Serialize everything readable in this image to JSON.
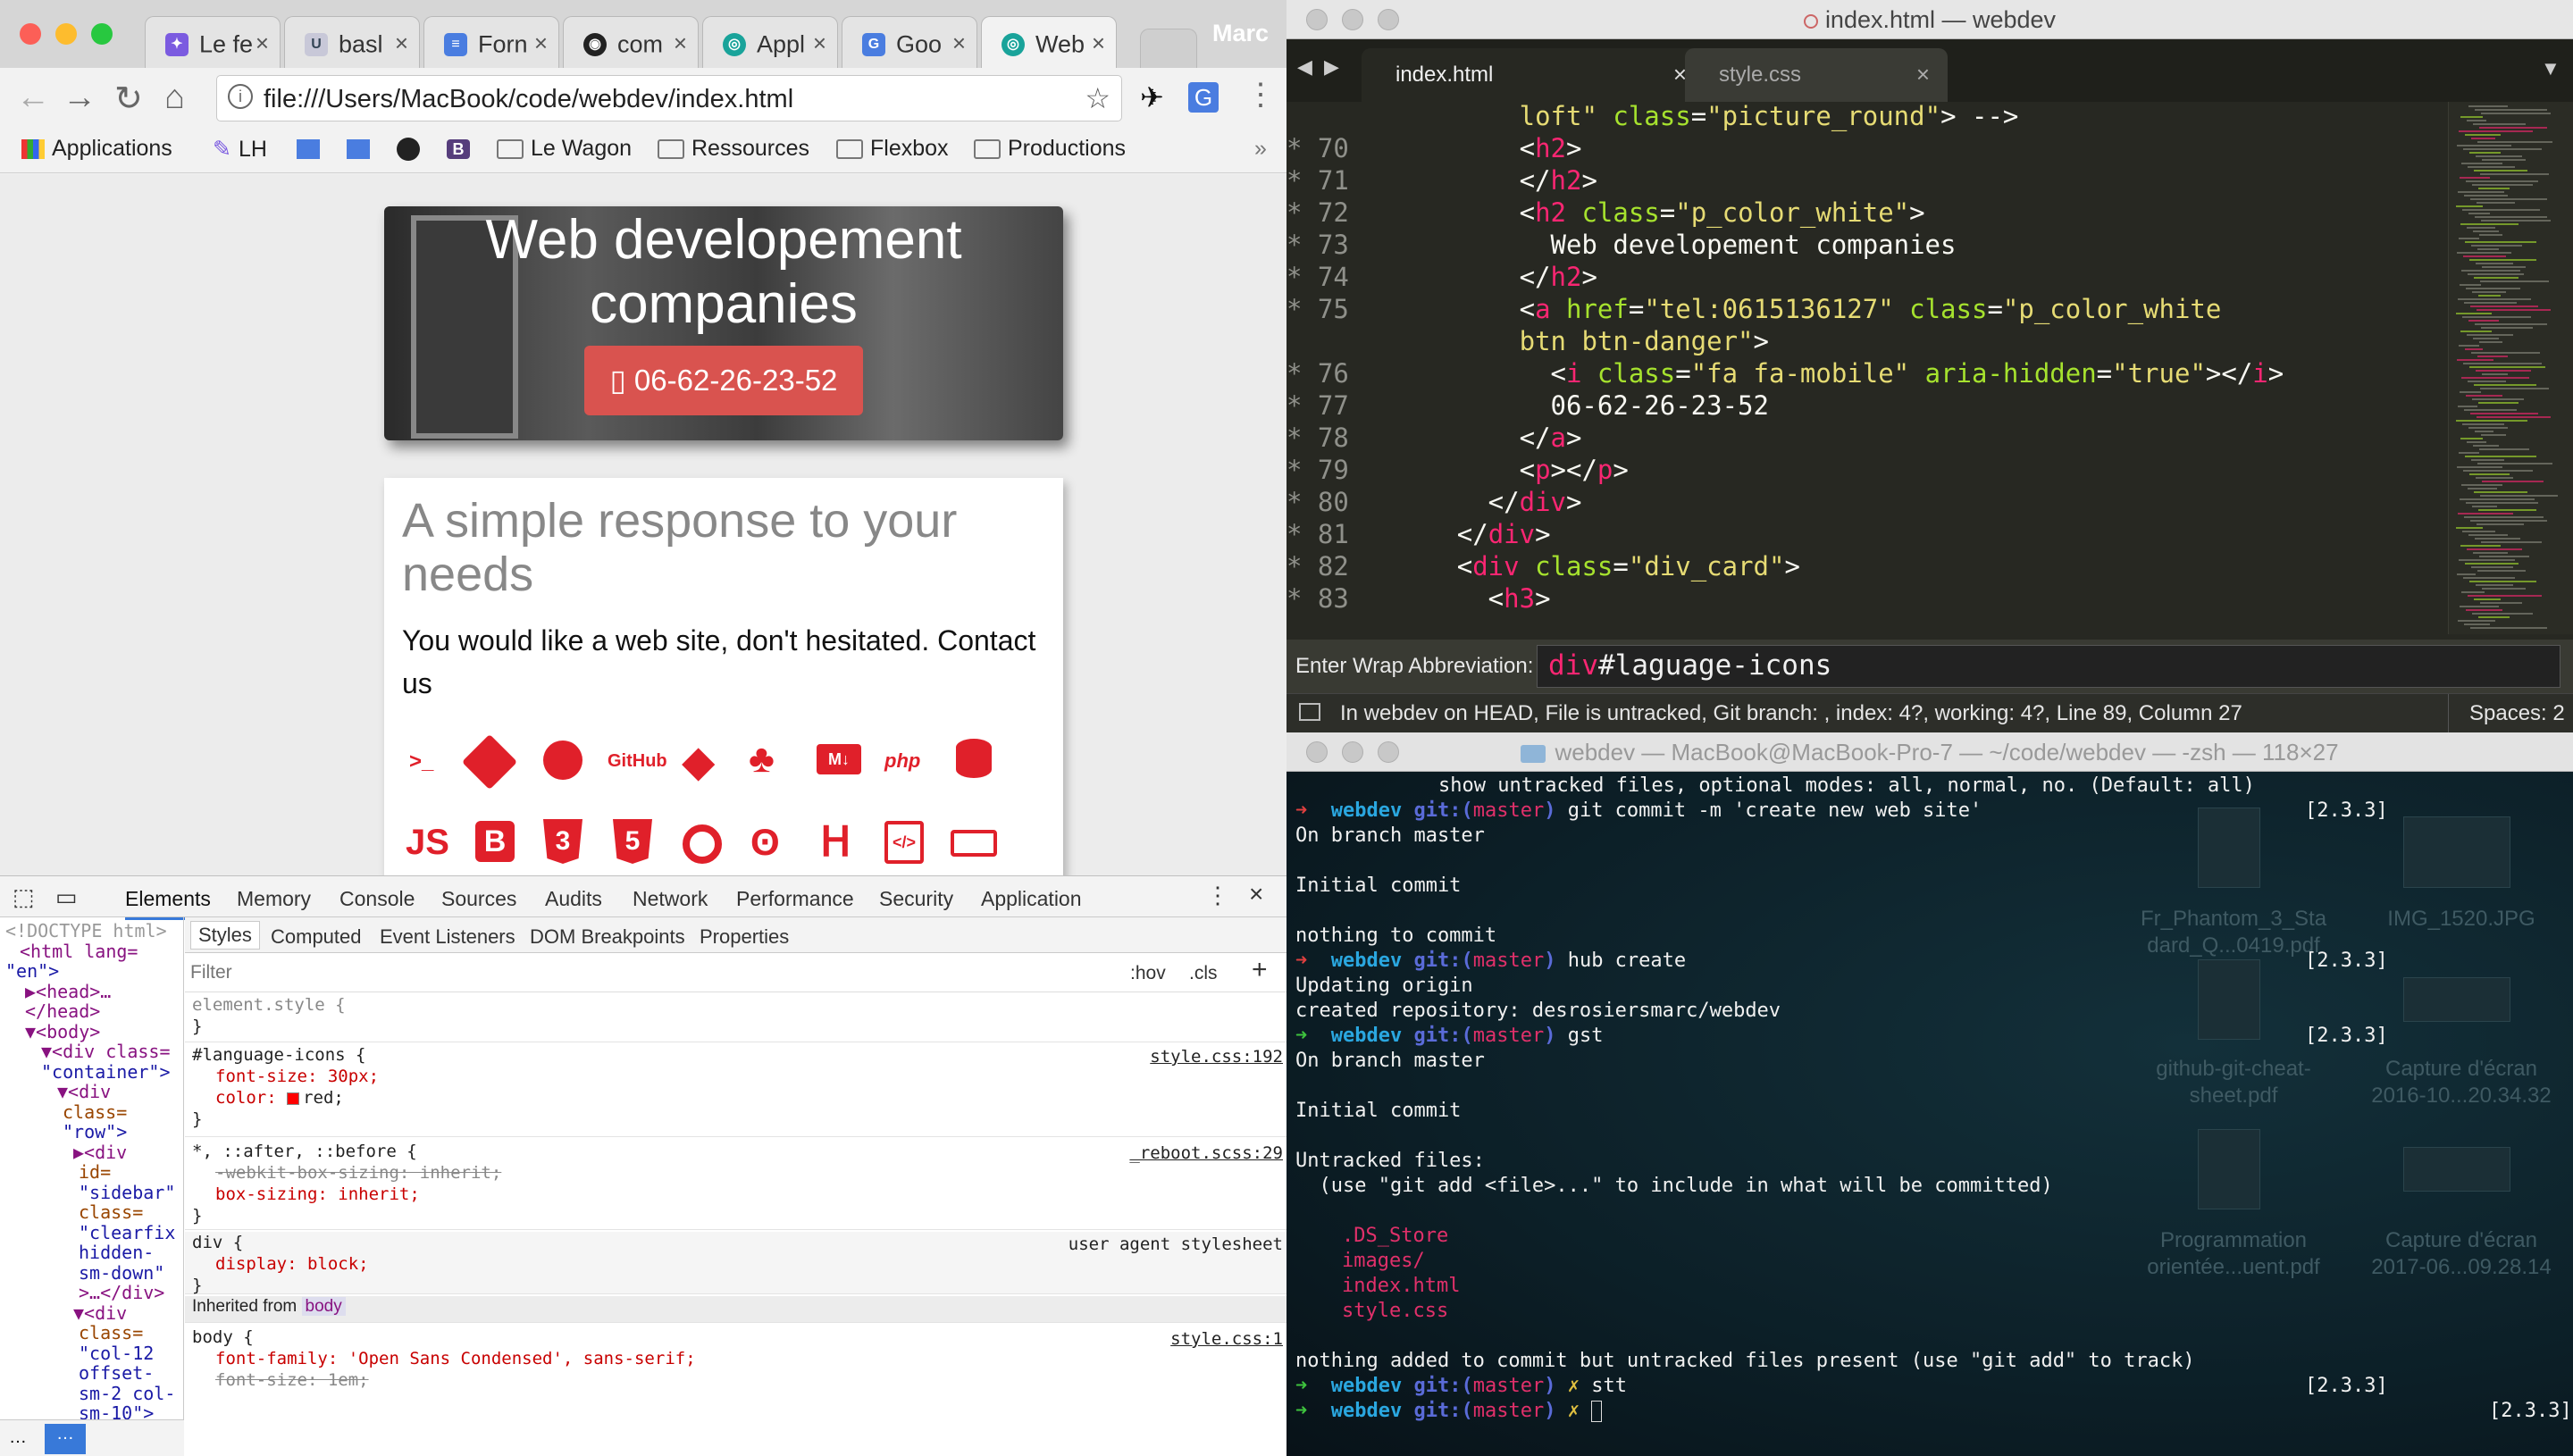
{
  "chrome": {
    "tabs": [
      {
        "label": "Le fe",
        "fav": "purple"
      },
      {
        "label": "basl",
        "fav": "UL"
      },
      {
        "label": "Forn",
        "fav": "doc"
      },
      {
        "label": "com",
        "fav": "github"
      },
      {
        "label": "Appl",
        "fav": "teal"
      },
      {
        "label": "Goo",
        "fav": "google"
      },
      {
        "label": "Web",
        "fav": "teal"
      }
    ],
    "profile": "Marc",
    "url": "file:///Users/MacBook/code/webdev/index.html",
    "bookmarks": [
      "Applications",
      "LH",
      "Le Wagon",
      "Ressources",
      "Flexbox",
      "Productions"
    ],
    "page": {
      "hero_title": "Web developement companies",
      "hero_phone": "06-62-26-23-52",
      "card_title": "A simple response to your needs",
      "card_text": "You would like a web site, don't hesitated. Contact us",
      "icons_row1": [
        ">_",
        "git",
        "github",
        "GitHub",
        "ruby",
        "sass",
        "M↓",
        "php",
        "db"
      ],
      "icons_row2": [
        "JS",
        "B",
        "css3",
        "html5",
        "chrome",
        "postgres",
        "heroku",
        "code",
        "bus"
      ]
    },
    "devtools": {
      "tabs": [
        "Elements",
        "Memory",
        "Console",
        "Sources",
        "Audits",
        "Network",
        "Performance",
        "Security",
        "Application"
      ],
      "style_tabs": [
        "Styles",
        "Computed",
        "Event Listeners",
        "DOM Breakpoints",
        "Properties"
      ],
      "filter_placeholder": "Filter",
      "hov": ":hov",
      "cls": ".cls",
      "dom_lines": [
        "<!DOCTYPE html>",
        "<html lang=",
        "\"en\">",
        "▶<head>…",
        "</head>",
        "▼<body>",
        "▼<div class=",
        "\"container\">",
        "▼<div",
        "class=",
        "\"row\">",
        "▶<div",
        "id=",
        "\"sidebar\"",
        "class=",
        "\"clearfix",
        "hidden-",
        "sm-down\"",
        ">…</div>",
        "▼<div",
        "class=",
        "\"col-12",
        "offset-",
        "sm-2 col-",
        "sm-10\">"
      ],
      "rules": {
        "element_style": "element.style {",
        "lang_selector": "#language-icons {",
        "lang_src": "style.css:192",
        "lang_p1": "font-size: 30px;",
        "lang_p2_name": "color:",
        "lang_p2_val": "red;",
        "reboot_selector": "*, ::after, ::before {",
        "reboot_src": "_reboot.scss:29",
        "reboot_p1": "-webkit-box-sizing: inherit;",
        "reboot_p2": "box-sizing: inherit;",
        "div_selector": "div {",
        "div_src": "user agent stylesheet",
        "div_p1": "display: block;",
        "inherited": "Inherited from",
        "inherited_tag": "body",
        "body_selector": "body {",
        "body_src": "style.css:1",
        "body_p1": "font-family: 'Open Sans Condensed', sans-serif;",
        "body_p2": "font-size: 1em;",
        "close_brace": "}"
      }
    }
  },
  "sublime": {
    "title": "index.html — webdev",
    "tabs": [
      "index.html",
      "style.css"
    ],
    "wrap_label": "Enter Wrap Abbreviation:",
    "wrap_value_tag": "div",
    "wrap_value_rest": "#laguage-icons",
    "status": "In webdev on HEAD, File is untracked, Git branch: , index: 4?, working: 4?, Line 89, Column 27",
    "spaces": "Spaces: 2"
  },
  "terminal": {
    "title": "webdev — MacBook@MacBook-Pro-7 — ~/code/webdev — -zsh — 118×27",
    "top_line": "show untracked files, optional modes: all, normal, no. (Default: all)",
    "prompt_dir": "webdev",
    "prompt_git": "git:(",
    "prompt_branch": "master",
    "prompt_close": ")",
    "ruby_version": "[2.3.3]",
    "cmd1": "git commit -m 'create new web site'",
    "on_branch": "On branch master",
    "initial_commit": "Initial commit",
    "nothing": "nothing to commit",
    "cmd2": "hub create",
    "updating": "Updating origin",
    "created": "created repository: desrosiersmarc/webdev",
    "cmd3": "gst",
    "untracked": "Untracked files:",
    "hint": "  (use \"git add <file>...\" to include in what will be committed)",
    "files": [
      ".DS_Store",
      "images/",
      "index.html",
      "style.css"
    ],
    "nothing_added": "nothing added to commit but untracked files present (use \"git add\" to track)",
    "cmd4": "stt",
    "desktop_files": [
      "Fr_Phantom_3_Sta",
      "dard_Q...0419.pdf",
      "IMG_1520.JPG",
      "github-git-cheat-",
      "sheet.pdf",
      "Capture d'écran",
      "2016-10...20.34.32",
      "Programmation",
      "orientée...uent.pdf",
      "Capture d'écran",
      "2017-06...09.28.14"
    ]
  },
  "colors": {
    "accent_red": "#d9534f",
    "icon_red": "#e0202a",
    "monokai_bg": "#272822"
  }
}
